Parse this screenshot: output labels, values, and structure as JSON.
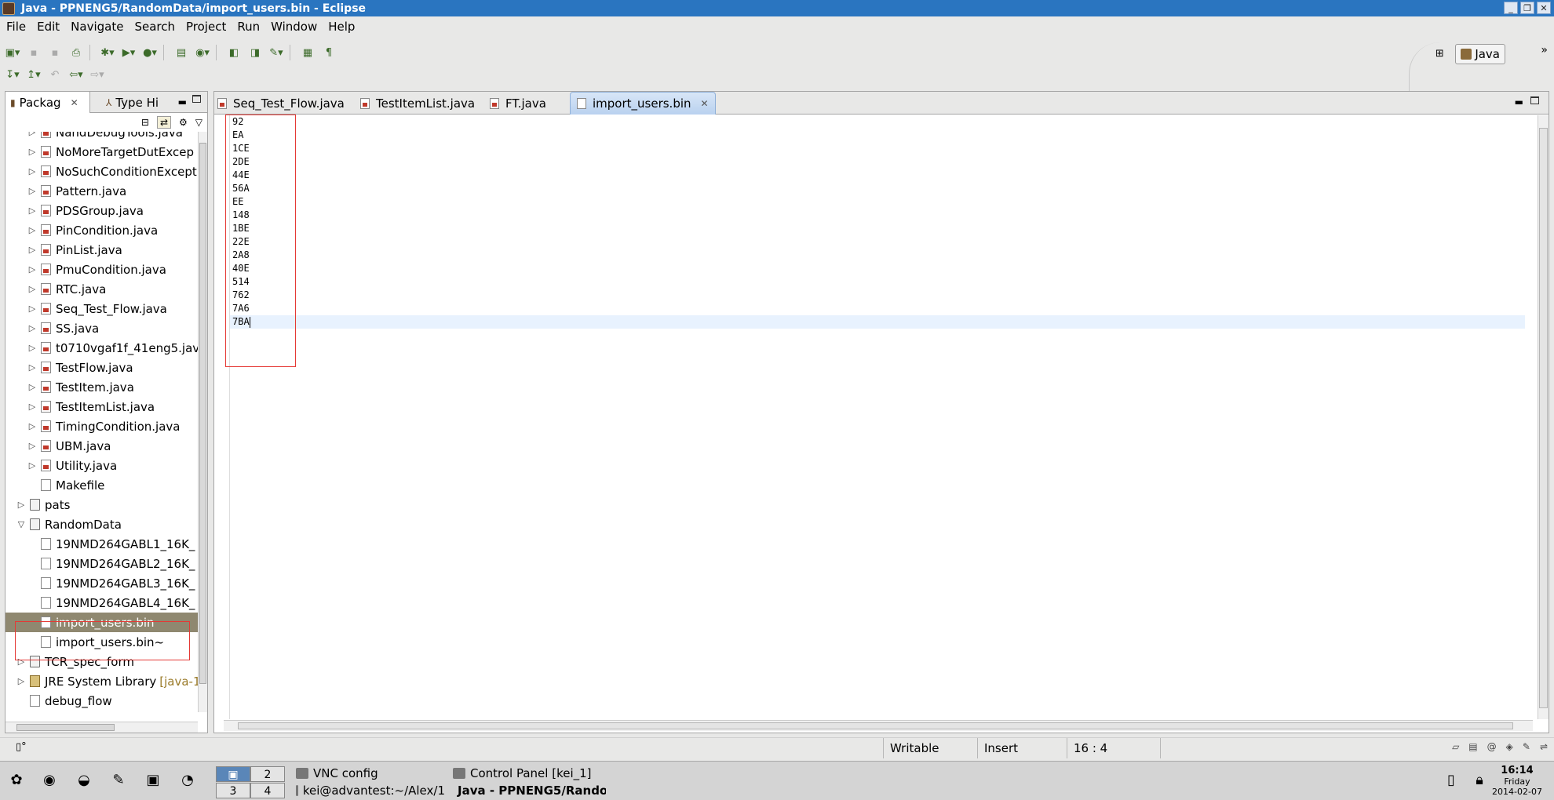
{
  "window": {
    "title": "Java - PPNENG5/RandomData/import_users.bin - Eclipse"
  },
  "menu": [
    "File",
    "Edit",
    "Navigate",
    "Search",
    "Project",
    "Run",
    "Window",
    "Help"
  ],
  "perspective": {
    "label": "Java"
  },
  "package_explorer": {
    "tabs": [
      "Packag",
      "Type Hi"
    ],
    "tree": [
      {
        "label": "NandDebugTools.java",
        "indent": 2,
        "kind": "java",
        "expandable": true
      },
      {
        "label": "NoMoreTargetDutExcep",
        "indent": 2,
        "kind": "java",
        "expandable": true
      },
      {
        "label": "NoSuchConditionExcept",
        "indent": 2,
        "kind": "java",
        "expandable": true
      },
      {
        "label": "Pattern.java",
        "indent": 2,
        "kind": "java",
        "expandable": true
      },
      {
        "label": "PDSGroup.java",
        "indent": 2,
        "kind": "java",
        "expandable": true
      },
      {
        "label": "PinCondition.java",
        "indent": 2,
        "kind": "java",
        "expandable": true
      },
      {
        "label": "PinList.java",
        "indent": 2,
        "kind": "java",
        "expandable": true
      },
      {
        "label": "PmuCondition.java",
        "indent": 2,
        "kind": "java",
        "expandable": true
      },
      {
        "label": "RTC.java",
        "indent": 2,
        "kind": "java",
        "expandable": true
      },
      {
        "label": "Seq_Test_Flow.java",
        "indent": 2,
        "kind": "java",
        "expandable": true
      },
      {
        "label": "SS.java",
        "indent": 2,
        "kind": "java",
        "expandable": true
      },
      {
        "label": "t0710vgaf1f_41eng5.jav",
        "indent": 2,
        "kind": "java",
        "expandable": true
      },
      {
        "label": "TestFlow.java",
        "indent": 2,
        "kind": "java",
        "expandable": true
      },
      {
        "label": "TestItem.java",
        "indent": 2,
        "kind": "java",
        "expandable": true
      },
      {
        "label": "TestItemList.java",
        "indent": 2,
        "kind": "java",
        "expandable": true
      },
      {
        "label": "TimingCondition.java",
        "indent": 2,
        "kind": "java",
        "expandable": true
      },
      {
        "label": "UBM.java",
        "indent": 2,
        "kind": "java",
        "expandable": true
      },
      {
        "label": "Utility.java",
        "indent": 2,
        "kind": "java",
        "expandable": true
      },
      {
        "label": "Makefile",
        "indent": 2,
        "kind": "file",
        "expandable": false
      },
      {
        "label": "pats",
        "indent": 1,
        "kind": "pkg",
        "expandable": true
      },
      {
        "label": "RandomData",
        "indent": 1,
        "kind": "pkg",
        "expandable": true,
        "expanded": true
      },
      {
        "label": "19NMD264GABL1_16K_",
        "indent": 2,
        "kind": "file",
        "expandable": false
      },
      {
        "label": "19NMD264GABL2_16K_",
        "indent": 2,
        "kind": "file",
        "expandable": false
      },
      {
        "label": "19NMD264GABL3_16K_",
        "indent": 2,
        "kind": "file",
        "expandable": false
      },
      {
        "label": "19NMD264GABL4_16K_",
        "indent": 2,
        "kind": "file",
        "expandable": false
      },
      {
        "label": "import_users.bin",
        "indent": 2,
        "kind": "file",
        "expandable": false,
        "selected": true
      },
      {
        "label": "import_users.bin~",
        "indent": 2,
        "kind": "file",
        "expandable": false
      },
      {
        "label": "TCR_spec_form",
        "indent": 1,
        "kind": "pkg",
        "expandable": true
      },
      {
        "label": "JRE System Library",
        "suffix": "[java-1",
        "indent": 1,
        "kind": "jre",
        "expandable": true
      },
      {
        "label": "debug_flow",
        "indent": 1,
        "kind": "file",
        "expandable": false
      }
    ]
  },
  "editor": {
    "tabs": [
      {
        "label": "Seq_Test_Flow.java",
        "kind": "java"
      },
      {
        "label": "TestItemList.java",
        "kind": "java"
      },
      {
        "label": "FT.java",
        "kind": "java"
      },
      {
        "label": "import_users.bin",
        "kind": "file",
        "active": true
      }
    ],
    "lines": [
      "92",
      "EA",
      "1CE",
      "2DE",
      "44E",
      "56A",
      "EE",
      "148",
      "1BE",
      "22E",
      "2A8",
      "40E",
      "514",
      "762",
      "7A6",
      "7BA"
    ]
  },
  "status": {
    "writable": "Writable",
    "mode": "Insert",
    "position": "16 : 4"
  },
  "taskbar": {
    "workspaces": [
      "1",
      "2",
      "3",
      "4"
    ],
    "tasks": [
      "VNC config",
      "Control Panel  [kei_1]",
      "kei@advantest:~/Alex/1",
      "Java - PPNENG5/Rando"
    ],
    "clock": {
      "time": "16:14",
      "day": "Friday",
      "date": "2014-02-07"
    }
  },
  "colors": {
    "titlebar": "#2a75c0",
    "selection": "#8f8870",
    "highlight_box": "#e53935",
    "current_line": "#e8f2fe"
  }
}
